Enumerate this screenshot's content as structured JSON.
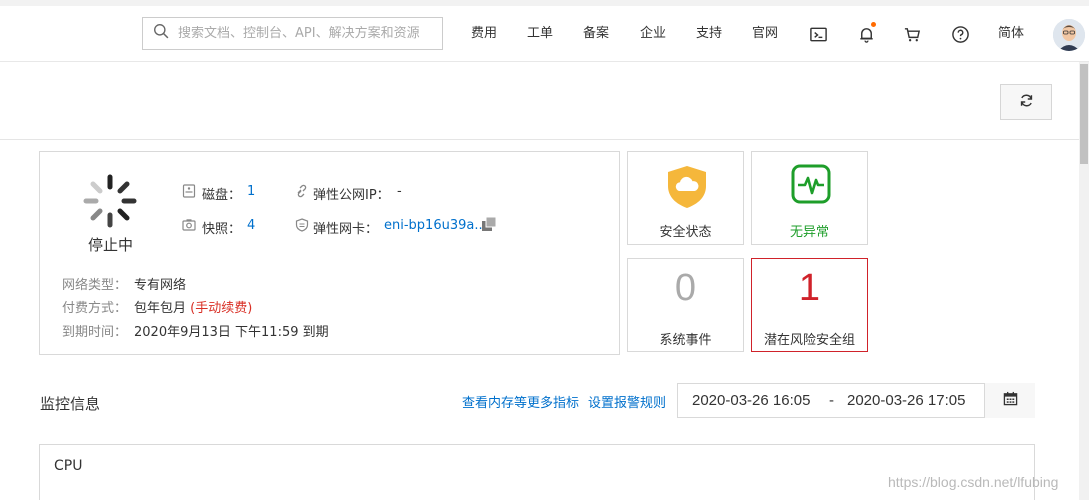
{
  "header": {
    "search_placeholder": "搜索文档、控制台、API、解决方案和资源",
    "nav": [
      "费用",
      "工单",
      "备案",
      "企业",
      "支持",
      "官网"
    ],
    "icons": [
      "terminal-icon",
      "bell-icon",
      "cart-icon",
      "help-icon"
    ],
    "lang": "简体",
    "notify_color": "#ff6a00"
  },
  "instance": {
    "status": "停止中",
    "disk_label": "磁盘：",
    "disk_value": "1",
    "snapshot_label": "快照：",
    "snapshot_value": "4",
    "eip_label": "弹性公网IP：",
    "eip_value": "-",
    "eni_label": "弹性网卡：",
    "eni_value": "eni-bp16u39a...",
    "network_label": "网络类型：",
    "network_value": "专有网络",
    "billing_label": "付费方式：",
    "billing_value": "包年包月",
    "billing_renew": "(手动续费)",
    "expire_label": "到期时间：",
    "expire_value": "2020年9月13日 下午11:59 到期"
  },
  "cards": {
    "security_label": "安全状态",
    "normal_label": "无异常",
    "events_count": "0",
    "events_label": "系统事件",
    "risk_count": "1",
    "risk_label": "潜在风险安全组",
    "alert_color": "#d0222a",
    "ok_color": "#1e9e2a"
  },
  "monitor": {
    "title": "监控信息",
    "link_more": "查看内存等更多指标",
    "link_alarm": "设置报警规则",
    "date_start": "2020-03-26 16:05",
    "date_sep": "-",
    "date_end": "2020-03-26 17:05",
    "cpu_title": "CPU"
  },
  "watermark": "https://blog.csdn.net/lfubing"
}
